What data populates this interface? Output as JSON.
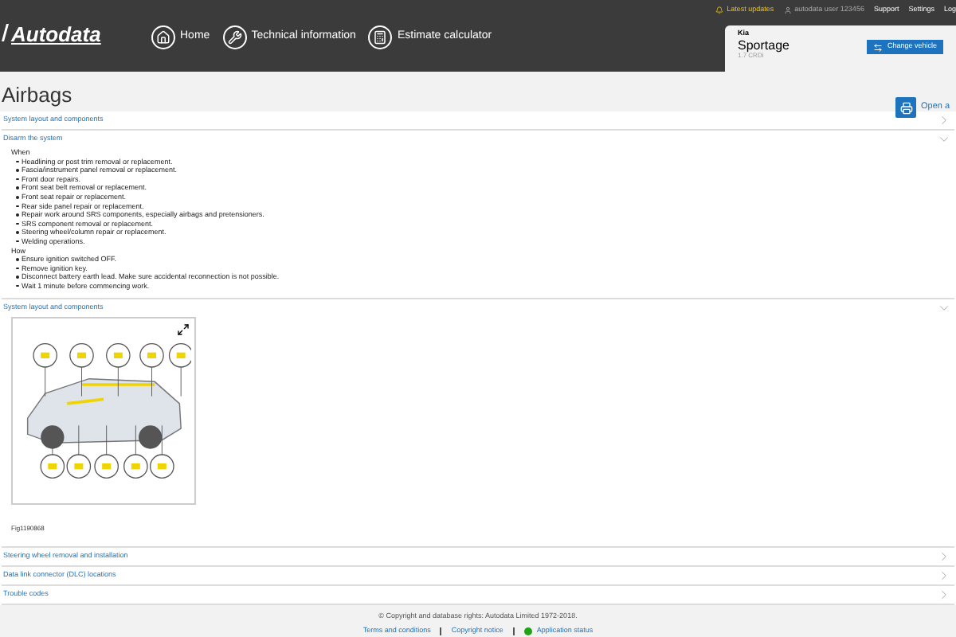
{
  "header": {
    "logo": "Autodata",
    "nav": [
      {
        "label": "Home",
        "kind": "home"
      },
      {
        "label": "Technical information",
        "kind": "wrench"
      },
      {
        "label": "Estimate calculator",
        "kind": "calculator"
      }
    ],
    "top_links": [
      {
        "label": "Latest updates",
        "kind": "updates"
      },
      {
        "label": "autodata user 123456",
        "kind": "user"
      },
      {
        "label": "Support",
        "kind": "link"
      },
      {
        "label": "Settings",
        "kind": "link"
      },
      {
        "label": "Log",
        "kind": "link"
      }
    ],
    "vehicle": {
      "make": "Kia",
      "model": "Sportage",
      "engine": "1.7 CRDi",
      "button": "Change vehicle"
    }
  },
  "page": {
    "title": "Airbags",
    "open_link": "Open a"
  },
  "sections": [
    {
      "title": "System layout and components",
      "expanded": false
    },
    {
      "title": "Disarm the system",
      "expanded": true,
      "kind": "list",
      "groups": [
        {
          "heading": "When",
          "items": [
            "Headlining or post trim removal or replacement.",
            "Fascia/instrument panel removal or replacement.",
            "Front door repairs.",
            "Front seat belt removal or replacement.",
            "Front seat repair or replacement.",
            "Rear side panel repair or replacement.",
            "Repair work around SRS components, especially airbags and pretensioners.",
            "SRS component removal or replacement.",
            "Steering wheel/column repair or replacement.",
            "Welding operations."
          ]
        },
        {
          "heading": "How",
          "items": [
            "Ensure ignition switched OFF.",
            "Remove ignition key.",
            "Disconnect battery earth lead. Make sure accidental reconnection is not possible.",
            "Wait 1 minute before commencing work."
          ]
        }
      ]
    },
    {
      "title": "System layout and components",
      "expanded": true,
      "kind": "figure",
      "caption": "Fig1190868"
    },
    {
      "title": "Steering wheel removal and installation",
      "expanded": false
    },
    {
      "title": "Data link connector (DLC) locations",
      "expanded": false
    },
    {
      "title": "Trouble codes",
      "expanded": false
    }
  ],
  "footer": {
    "copyright": "© Copyright and database rights: Autodata Limited 1972-2018.",
    "links": [
      {
        "label": "Terms and conditions",
        "kind": "link"
      },
      {
        "label": "Copyright notice",
        "kind": "link"
      },
      {
        "label": "Application status",
        "kind": "status",
        "color": "#22a316"
      }
    ]
  }
}
